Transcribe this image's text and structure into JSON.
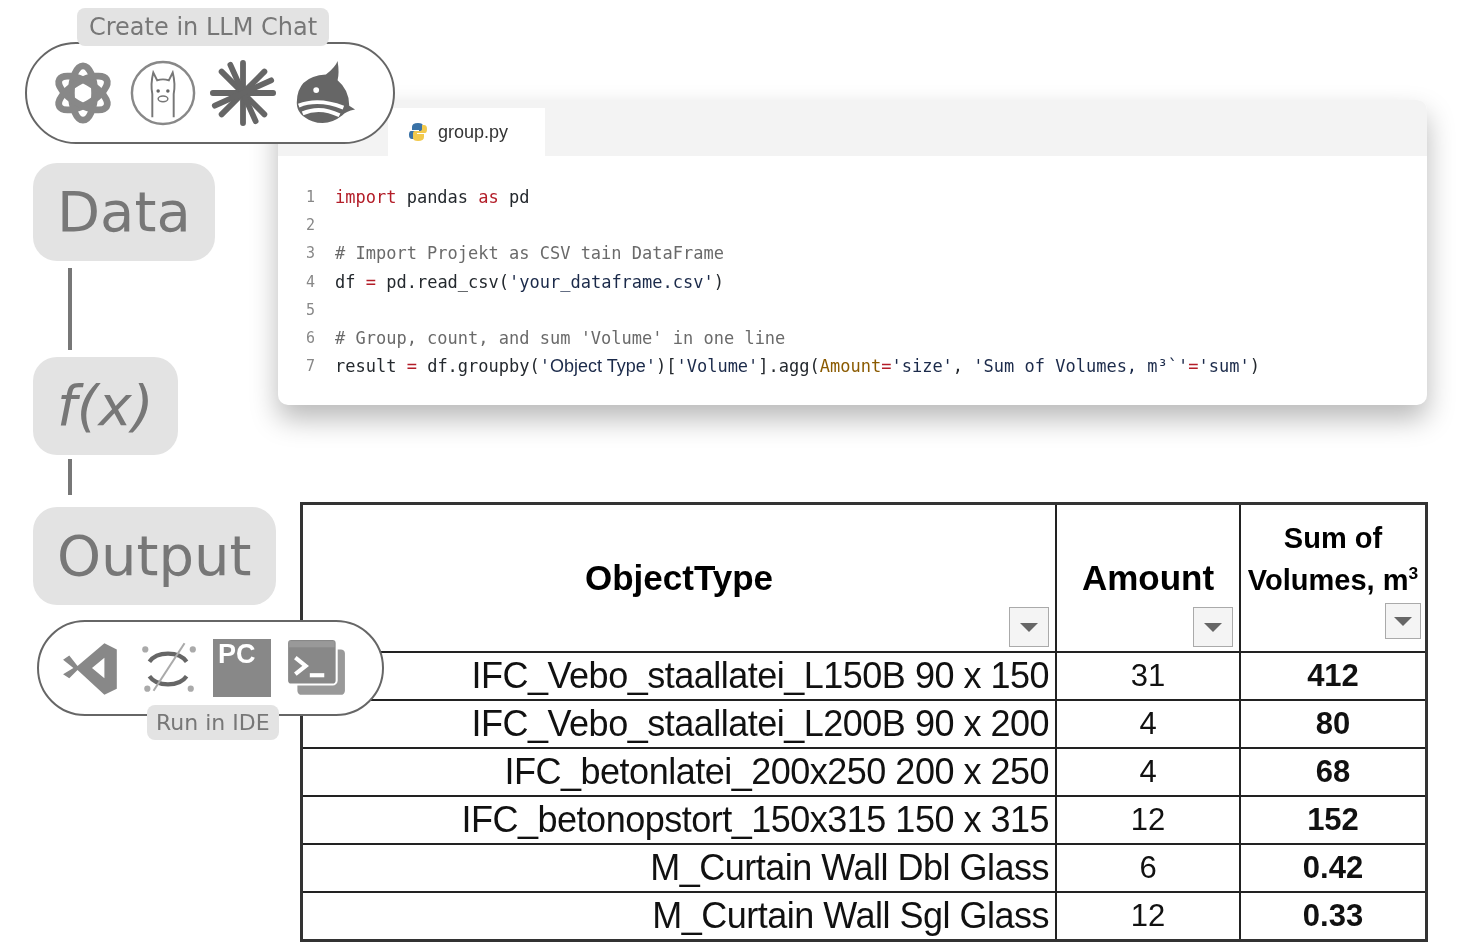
{
  "llm_panel": {
    "label": "Create in LLM Chat"
  },
  "steps": [
    {
      "label": "Data",
      "italic": false
    },
    {
      "label": "f(x)",
      "italic": true
    },
    {
      "label": "Output",
      "italic": false
    }
  ],
  "ide_panel": {
    "label": "Run in IDE",
    "logo_text": "PC"
  },
  "editor": {
    "tab": "group.py",
    "lines": [
      {
        "number": "1",
        "tokens": [
          {
            "kind": "keyword",
            "text": "import"
          },
          {
            "kind": "plain",
            "text": " pandas "
          },
          {
            "kind": "keyword",
            "text": "as"
          },
          {
            "kind": "plain",
            "text": " pd"
          }
        ]
      },
      {
        "number": "2"
      },
      {
        "number": "3",
        "tokens": [
          {
            "kind": "comment",
            "text": "# Import Projekt as CSV tain DataFrame"
          }
        ]
      },
      {
        "number": "4",
        "tokens": [
          {
            "kind": "plain",
            "text": "df "
          },
          {
            "kind": "operator",
            "text": "="
          },
          {
            "kind": "plain",
            "text": " pd.read_csv("
          },
          {
            "kind": "string",
            "text": "'your_dataframe.csv'"
          },
          {
            "kind": "plain",
            "text": ")"
          }
        ]
      },
      {
        "number": "5"
      },
      {
        "number": "6",
        "tokens": [
          {
            "kind": "comment",
            "text": "# Group, count, and sum 'Volume' in one line"
          }
        ]
      },
      {
        "number": "7",
        "tokens": [
          {
            "kind": "plain",
            "text": "result "
          },
          {
            "kind": "operator",
            "text": "="
          },
          {
            "kind": "plain",
            "text": " df.groupby("
          },
          {
            "kind": "string",
            "text": "'"
          },
          {
            "kind": "sans",
            "text": "Object Type"
          },
          {
            "kind": "string",
            "text": "'"
          },
          {
            "kind": "plain",
            "text": ")["
          },
          {
            "kind": "string",
            "text": "'Volume'"
          },
          {
            "kind": "plain",
            "text": "].agg("
          },
          {
            "kind": "param",
            "text": "Amount"
          },
          {
            "kind": "operator",
            "text": "="
          },
          {
            "kind": "string",
            "text": "'size'"
          },
          {
            "kind": "plain",
            "text": ", "
          },
          {
            "kind": "string",
            "text": "'Sum of Volumes, m³`'"
          },
          {
            "kind": "operator",
            "text": "="
          },
          {
            "kind": "string",
            "text": "'sum'"
          },
          {
            "kind": "plain",
            "text": ")"
          }
        ]
      }
    ]
  },
  "table": {
    "columns": [
      {
        "label": "ObjectType"
      },
      {
        "label": "Amount"
      },
      {
        "label": "Sum of Volumes, m$^{3}$"
      }
    ],
    "rows": [
      {
        "object_type": "IFC_Vebo_staallatei_L150B 90 x 150",
        "amount": "31",
        "sum": "412"
      },
      {
        "object_type": "IFC_Vebo_staallatei_L200B 90 x 200",
        "amount": "4",
        "sum": "80"
      },
      {
        "object_type": "IFC_betonlatei_200x250 200 x 250",
        "amount": "4",
        "sum": "68"
      },
      {
        "object_type": "IFC_betonopstort_150x315 150 x 315",
        "amount": "12",
        "sum": "152"
      },
      {
        "object_type": "M_Curtain Wall Dbl Glass",
        "amount": "6",
        "sum": "0.42"
      },
      {
        "object_type": "M_Curtain Wall Sgl Glass",
        "amount": "12",
        "sum": "0.33"
      }
    ]
  }
}
